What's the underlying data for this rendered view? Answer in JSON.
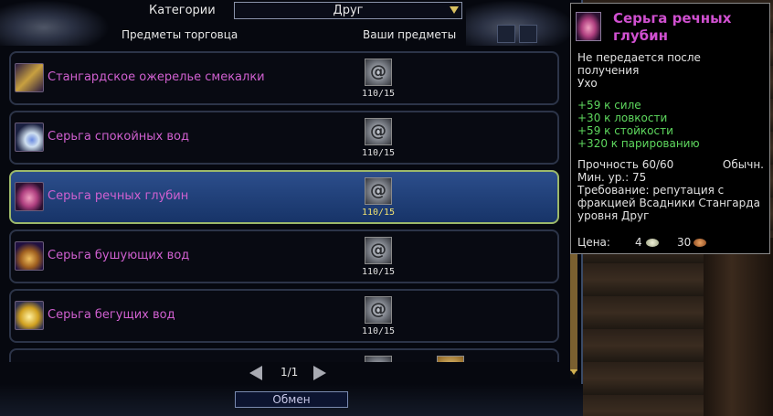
{
  "header": {
    "category_label": "Категории",
    "category_value": "Друг",
    "col_vendor_items": "Предметы торговца",
    "col_your_items": "Ваши предметы"
  },
  "items": [
    {
      "name": "Стангардское ожерелье смекалки",
      "cost_qty": "110/15",
      "icon": "necklace-icon"
    },
    {
      "name": "Серьга спокойных вод",
      "cost_qty": "110/15",
      "icon": "earring-blue-icon"
    },
    {
      "name": "Серьга речных глубин",
      "cost_qty": "110/15",
      "icon": "earring-pink-icon",
      "selected": true
    },
    {
      "name": "Серьга бушующих вод",
      "cost_qty": "110/15",
      "icon": "earring-gold-icon"
    },
    {
      "name": "Серьга бегущих вод",
      "cost_qty": "110/15",
      "icon": "earring-yellow-icon"
    }
  ],
  "pager": {
    "text": "1/1"
  },
  "exchange_button": "Обмен",
  "tooltip": {
    "title": "Серьга речных глубин",
    "bind_line1": "Не передается после",
    "bind_line2": "получения",
    "slot": "Ухо",
    "stats": [
      "+59 к силе",
      "+30 к ловкости",
      "+59 к стойкости",
      "+320 к парированию"
    ],
    "durability": "Прочность 60/60",
    "quality": "Обычн.",
    "min_level": "Мин. ур.: 75",
    "req_line1": "Требование: репутация с",
    "req_line2": "фракцией Всадники Стангарда",
    "req_line3": "уровня Друг",
    "price_label": "Цена:",
    "price_silver": "4",
    "price_bronze": "30"
  },
  "colors": {
    "item_name": "#d060d0",
    "stat_green": "#5ed85e",
    "selected_row": "#2c4e8c",
    "selected_border": "#9cb86a"
  }
}
